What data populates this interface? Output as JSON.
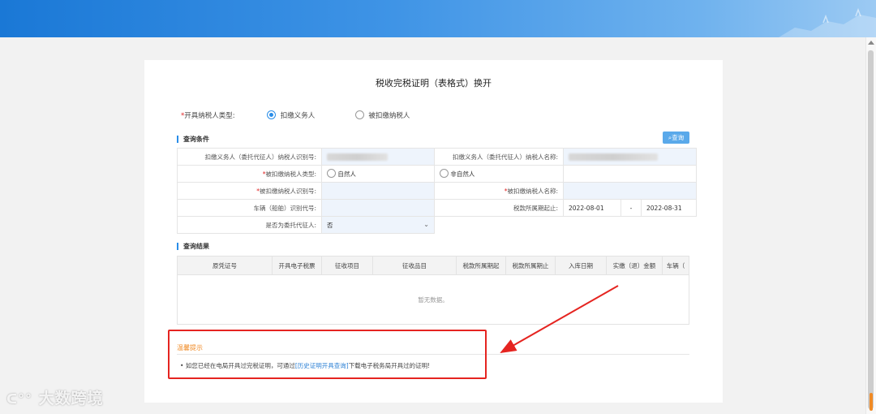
{
  "page": {
    "title": "税收完税证明（表格式）换开"
  },
  "issuer_type": {
    "required_mark": "*",
    "label": "开具纳税人类型:",
    "options": [
      {
        "label": "扣缴义务人",
        "selected": true
      },
      {
        "label": "被扣缴纳税人",
        "selected": false
      }
    ]
  },
  "query": {
    "section_title": "查询条件",
    "button_label": "查询",
    "fields": {
      "withholder_id_label": "扣缴义务人（委托代征人）纳税人识别号:",
      "withholder_name_label": "扣缴义务人（委托代征人）纳税人名称:",
      "payer_type_label": "被扣缴纳税人类型:",
      "payer_type_options": [
        "自然人",
        "非自然人"
      ],
      "payer_id_label": "被扣缴纳税人识别号:",
      "payer_name_label": "被扣缴纳税人名称:",
      "vehicle_label": "车辆（船舶）识别代号:",
      "period_label": "税款所属期起止:",
      "period_start": "2022-08-01",
      "period_sep": "-",
      "period_end": "2022-08-31",
      "agent_label": "是否为委托代征人:",
      "agent_value": "否"
    }
  },
  "results": {
    "section_title": "查询结果",
    "columns": [
      "原凭证号",
      "开具电子税票",
      "征收项目",
      "征收品目",
      "税款所属期起",
      "税款所属期止",
      "入库日期",
      "实缴（退）金额",
      "车辆（"
    ],
    "empty_text": "暂无数据。"
  },
  "tips": {
    "title": "温馨提示",
    "bullet": "•",
    "text_before": "如您已经在电局开具过完税证明，可通过",
    "link": "[历史证明开具查询]",
    "text_after": "下载电子税务局开具过的证明!"
  },
  "watermark": {
    "text": "大数跨境"
  },
  "colors": {
    "accent": "#2a8de8",
    "annotation": "#e52420",
    "tip_title": "#f08a24"
  }
}
